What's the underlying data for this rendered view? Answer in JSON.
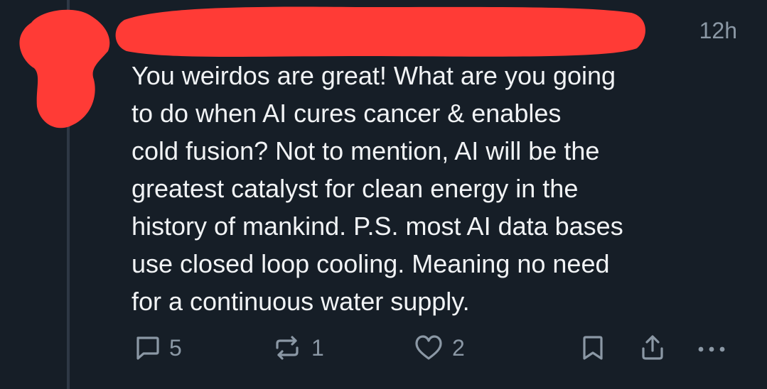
{
  "post": {
    "timestamp": "12h",
    "text_lines": [
      "You weirdos are great! What are you going",
      "to do when AI cures cancer & enables",
      "cold fusion? Not to mention, AI will be the",
      "greatest catalyst for clean energy in the",
      "history of mankind. P.S. most AI data bases",
      "use closed loop cooling. Meaning no need",
      "for a continuous water supply."
    ]
  },
  "actions": {
    "reply_count": "5",
    "repost_count": "1",
    "like_count": "2"
  },
  "colors": {
    "background": "#161e27",
    "text": "#f1f3f5",
    "muted": "#8b98a5",
    "redaction": "#ff3b36"
  },
  "icons": [
    "reply-icon",
    "repost-icon",
    "heart-icon",
    "bookmark-icon",
    "share-icon",
    "more-icon"
  ]
}
